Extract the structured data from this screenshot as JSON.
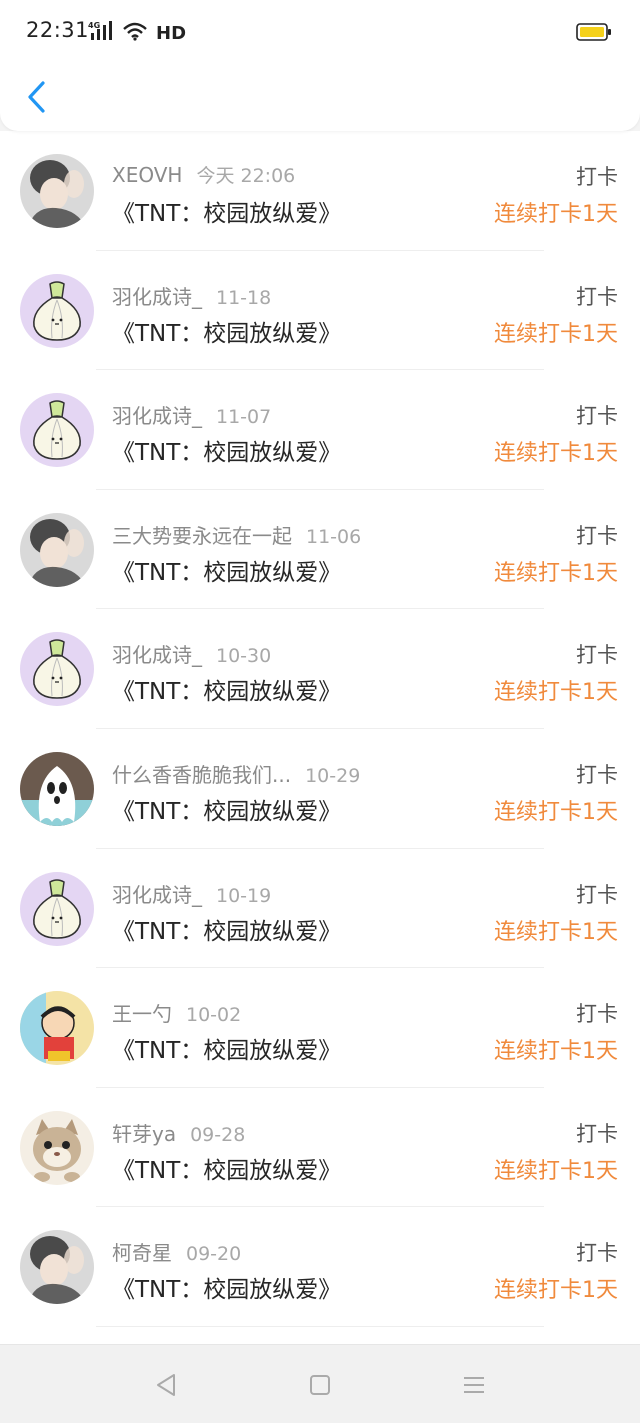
{
  "status_bar": {
    "time": "22:31",
    "network": "4G",
    "hd": "HD",
    "battery_color": "#f5d11a"
  },
  "header": {
    "back_icon": "chevron-left-icon",
    "accent_color": "#2196f3"
  },
  "colors": {
    "streak": "#f08a3c",
    "name": "#8a8a8a",
    "book": "#262626"
  },
  "records": [
    {
      "user": "XEOVH",
      "date": "今天 22:06",
      "book": "《TNT：校园放纵爱》",
      "tag": "打卡",
      "streak": "连续打卡1天",
      "avatar": "photo-avatar"
    },
    {
      "user": "羽化成诗_",
      "date": "11-18",
      "book": "《TNT：校园放纵爱》",
      "tag": "打卡",
      "streak": "连续打卡1天",
      "avatar": "garlic-avatar"
    },
    {
      "user": "羽化成诗_",
      "date": "11-07",
      "book": "《TNT：校园放纵爱》",
      "tag": "打卡",
      "streak": "连续打卡1天",
      "avatar": "garlic-avatar"
    },
    {
      "user": "三大势要永远在一起",
      "date": "11-06",
      "book": "《TNT：校园放纵爱》",
      "tag": "打卡",
      "streak": "连续打卡1天",
      "avatar": "photo-avatar"
    },
    {
      "user": "羽化成诗_",
      "date": "10-30",
      "book": "《TNT：校园放纵爱》",
      "tag": "打卡",
      "streak": "连续打卡1天",
      "avatar": "garlic-avatar"
    },
    {
      "user": "什么香香脆脆我们...",
      "date": "10-29",
      "book": "《TNT：校园放纵爱》",
      "tag": "打卡",
      "streak": "连续打卡1天",
      "avatar": "ghost-avatar"
    },
    {
      "user": "羽化成诗_",
      "date": "10-19",
      "book": "《TNT：校园放纵爱》",
      "tag": "打卡",
      "streak": "连续打卡1天",
      "avatar": "garlic-avatar"
    },
    {
      "user": "王一勺",
      "date": "10-02",
      "book": "《TNT：校园放纵爱》",
      "tag": "打卡",
      "streak": "连续打卡1天",
      "avatar": "cartoon-avatar"
    },
    {
      "user": "轩芽ya",
      "date": "09-28",
      "book": "《TNT：校园放纵爱》",
      "tag": "打卡",
      "streak": "连续打卡1天",
      "avatar": "cat-avatar"
    },
    {
      "user": "柯奇星",
      "date": "09-20",
      "book": "《TNT：校园放纵爱》",
      "tag": "打卡",
      "streak": "连续打卡1天",
      "avatar": "photo-avatar"
    }
  ],
  "nav_bar": {
    "back": "back-triangle-icon",
    "home": "home-square-icon",
    "menu": "menu-lines-icon"
  }
}
